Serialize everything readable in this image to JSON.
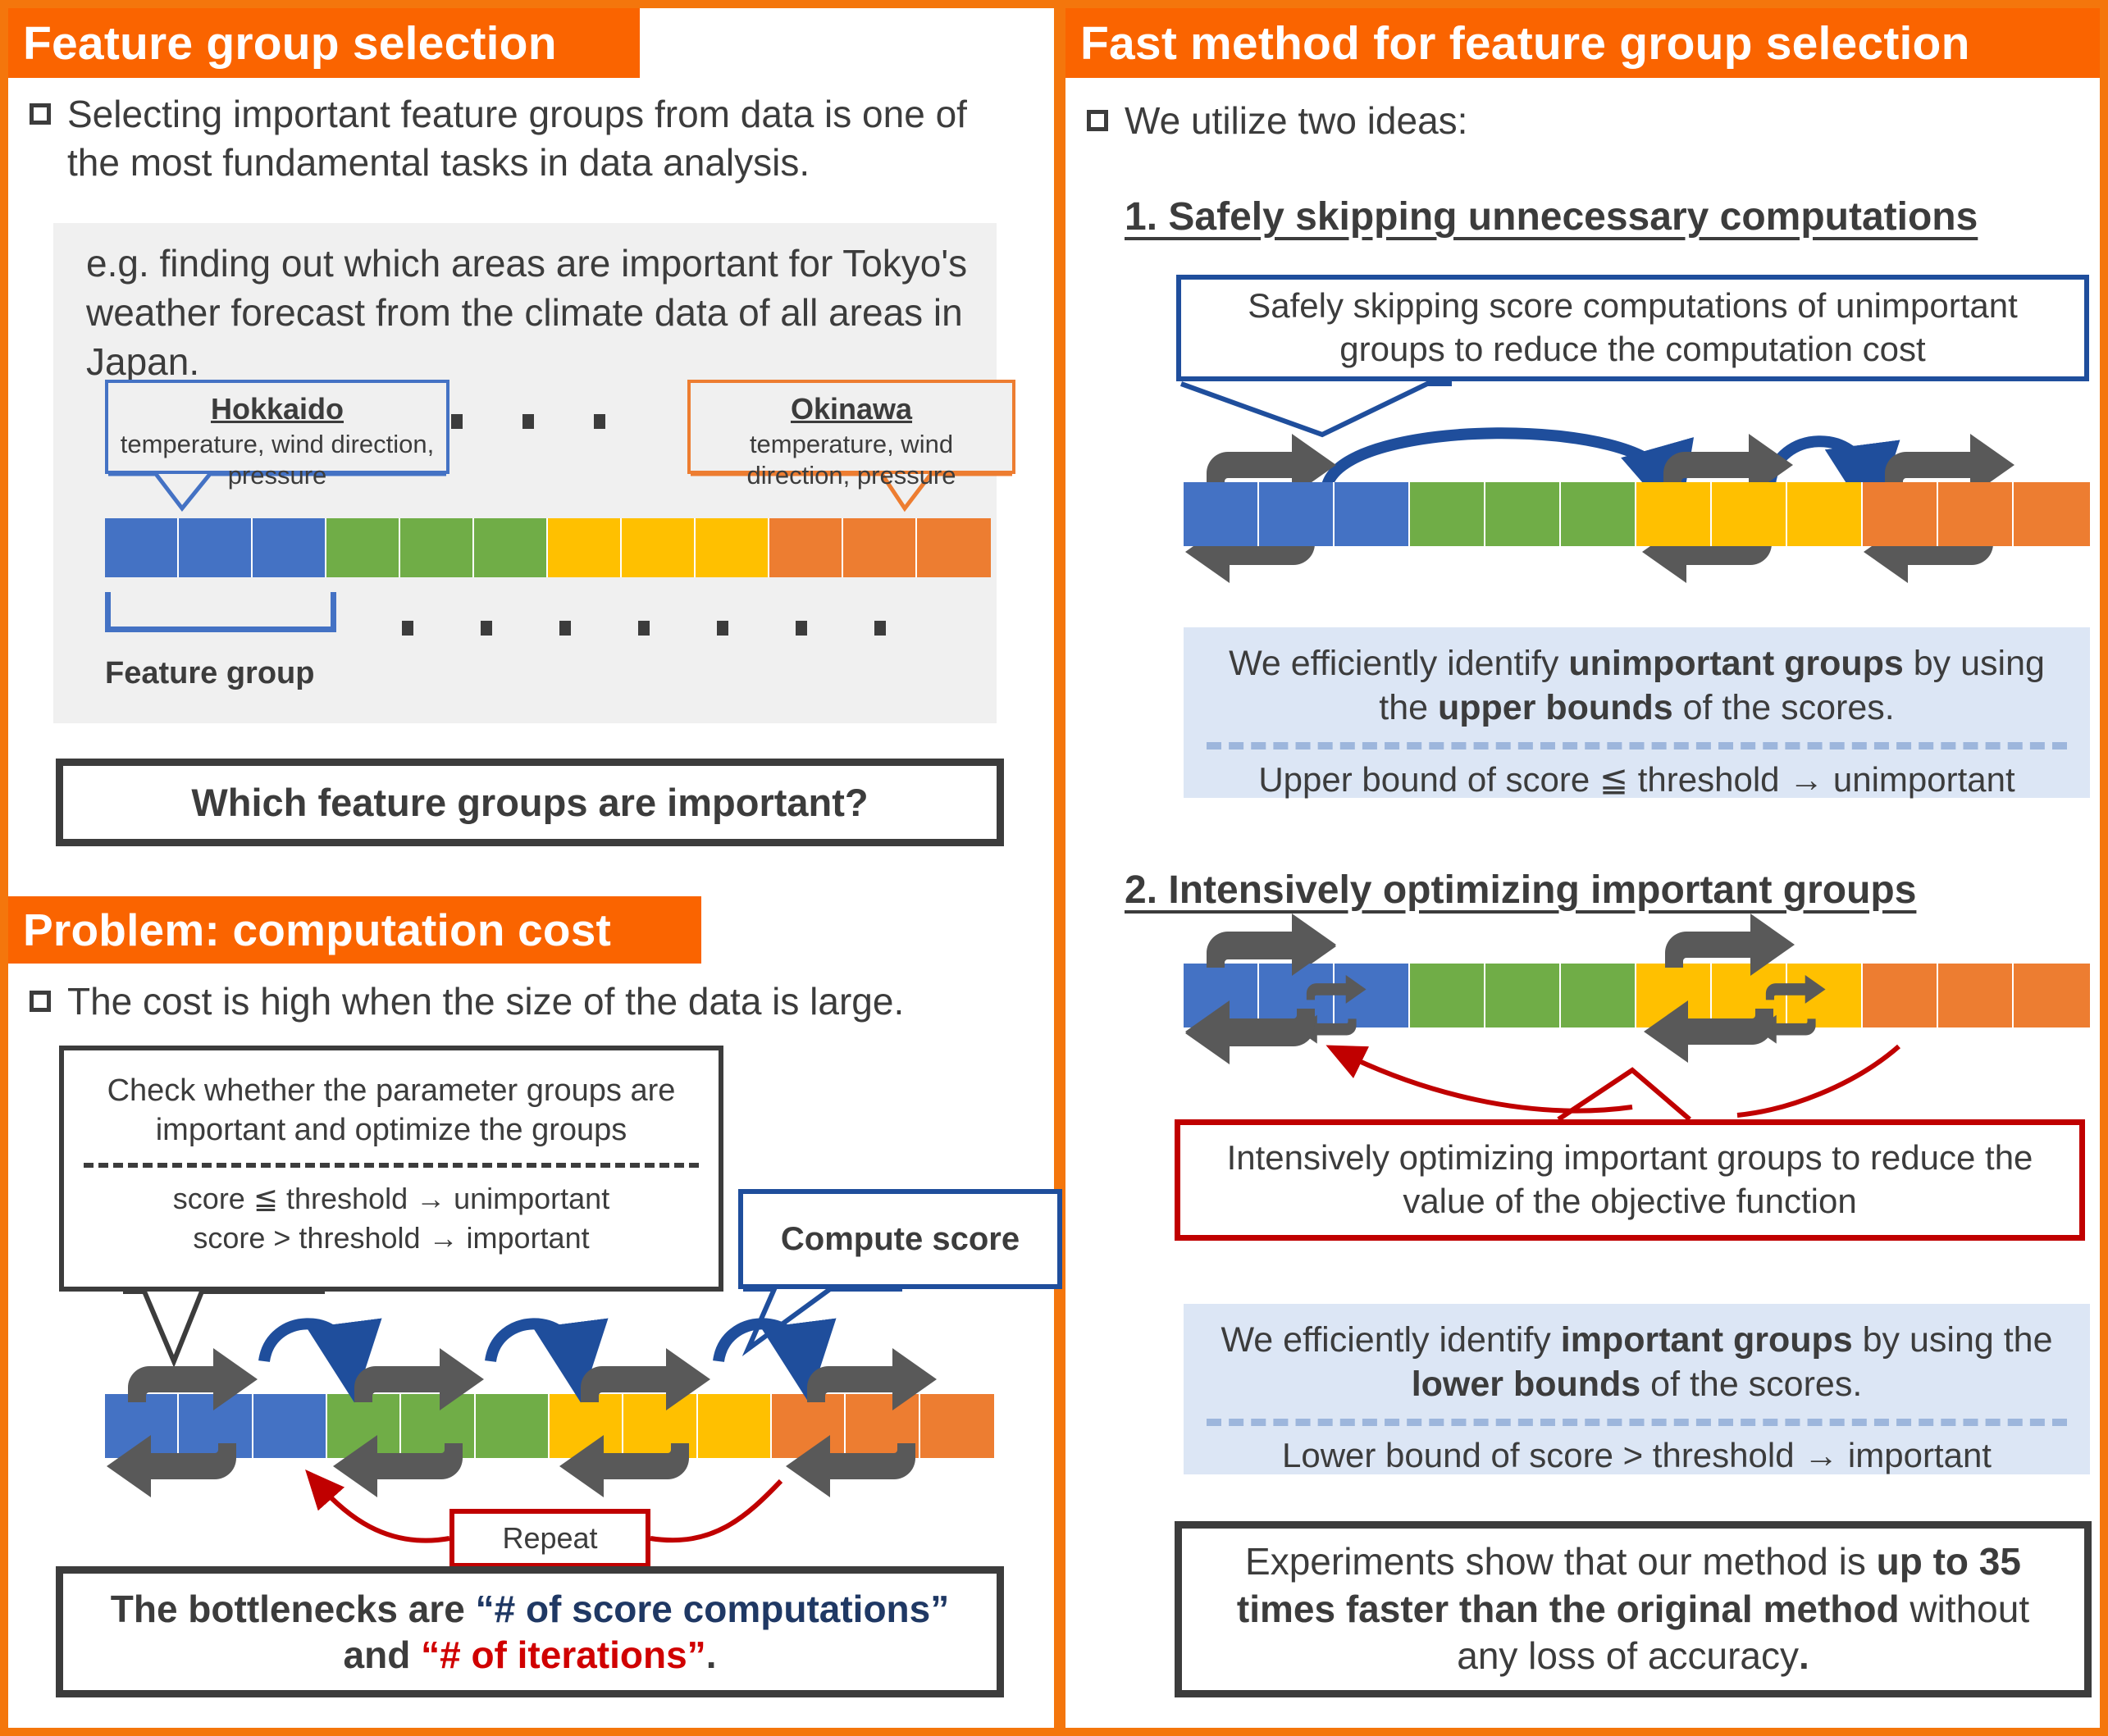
{
  "left_panel": {
    "header_feature": "Feature group selection",
    "bullet_selecting": "Selecting important feature groups from data is one of the most fundamental tasks in data analysis.",
    "example_text": "e.g. finding out which areas are important for Tokyo's weather forecast from the climate data of all areas in Japan.",
    "callout_hokkaido": {
      "title": "Hokkaido",
      "body": "temperature, wind direction, pressure"
    },
    "callout_okinawa": {
      "title": "Okinawa",
      "body": "temperature, wind direction, pressure"
    },
    "feature_group_label": "Feature group",
    "box_which": "Which feature groups are important?",
    "header_problem": "Problem: computation cost",
    "bullet_cost": "The cost is high when the size of the data is large.",
    "check_box": {
      "line1": "Check whether the parameter groups are important and optimize the groups",
      "rule1": "score ≦ threshold → unimportant",
      "rule2": "score > threshold → important"
    },
    "compute_score_label": "Compute score",
    "repeat_label": "Repeat",
    "bottleneck": {
      "part1": "The bottlenecks are ",
      "part2": "“# of score computations”",
      "part3": " and ",
      "part4": "“# of iterations”",
      "part5": "."
    }
  },
  "right_panel": {
    "header_fast": "Fast method for feature group selection",
    "bullet_ideas": "We utilize two ideas:",
    "sub_1": "1. Safely skipping unnecessary computations",
    "note_skip": "Safely skipping score computations of unimportant groups to reduce the computation cost",
    "info_upper": {
      "l1_a": "We efficiently identify ",
      "l1_b": "unimportant groups",
      "l1_c": " by using the ",
      "l1_d": "upper bounds",
      "l1_e": " of the scores.",
      "l2": "Upper bound of score ≦ threshold → unimportant"
    },
    "sub_2": "2. Intensively optimizing important groups",
    "note_intensive": "Intensively optimizing important groups to reduce the value of the objective function",
    "info_lower": {
      "l1_a": "We efficiently identify ",
      "l1_b": "important groups",
      "l1_c": " by using the ",
      "l1_d": "lower bounds",
      "l1_e": " of the scores.",
      "l2": "Lower bound of score > threshold → important"
    },
    "experiments": {
      "part1": "Experiments show that our method is ",
      "part2": "up to 35 times faster than the original method",
      "part3": " without any loss of accuracy",
      "part4": "."
    }
  },
  "colors": {
    "accent_orange": "#FA6400",
    "group_blue": "#4472C4",
    "group_green": "#70AD47",
    "group_yellow": "#FFC000",
    "group_orange": "#ED7D31",
    "dark_text": "#3C3C3C",
    "navy": "#1F3864",
    "red": "#C00000",
    "info_bg": "#DCE6F5"
  }
}
